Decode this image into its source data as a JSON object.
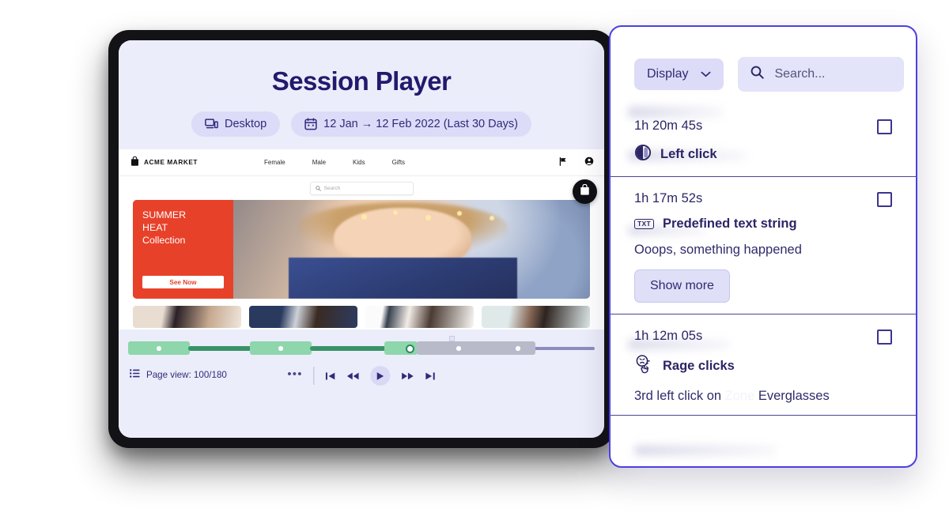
{
  "player": {
    "title": "Session Player",
    "device_pill": {
      "label": "Desktop",
      "icon": "desktop-mobile-icon"
    },
    "date_pill": {
      "label": "12 Jan → 12 Feb 2022 (Last 30 Days)",
      "icon": "calendar-icon"
    },
    "page_view": "Page view: 100/180",
    "page_view_icon": "list-icon",
    "more_label": "•••",
    "transport": [
      {
        "name": "skip-start-button",
        "glyph": "⏮"
      },
      {
        "name": "rewind-button",
        "glyph": "⏪"
      },
      {
        "name": "play-button",
        "glyph": "▶"
      },
      {
        "name": "fast-forward-button",
        "glyph": "⏩"
      },
      {
        "name": "skip-end-button",
        "glyph": "⏭"
      }
    ]
  },
  "site": {
    "brand": "ACME MARKET",
    "nav": [
      "Female",
      "Male",
      "Kids",
      "Gifts"
    ],
    "search_placeholder": "Search",
    "hero": {
      "line1": "SUMMER",
      "line2": "HEAT",
      "line3": "Collection",
      "cta": "See Now",
      "band_color": "#e8412a"
    }
  },
  "panel": {
    "display_label": "Display",
    "search_placeholder": "Search...",
    "events": [
      {
        "time": "1h 20m 45s",
        "type": "Left click",
        "icon": "left-click-icon",
        "checked": false
      },
      {
        "time": "1h 17m 52s",
        "type": "Predefined text string",
        "icon": "txt-icon",
        "icon_label": "TXT",
        "detail": "Ooops, something happened",
        "show_more": "Show more",
        "checked": false
      },
      {
        "time": "1h 12m 05s",
        "type": "Rage clicks",
        "icon": "rage-click-icon",
        "detail_prefix": "3rd left click on ",
        "detail_zone": "Zone",
        "detail_suffix": " Everglasses",
        "checked": false
      }
    ]
  },
  "colors": {
    "accent": "#4b3fe4",
    "title": "#221a6e",
    "timeline_active": "#8ed6ac",
    "timeline_bar": "#389368",
    "timeline_inactive": "#b8bac9",
    "banner_red": "#e8412a",
    "screen_bg": "#ecedfa"
  }
}
